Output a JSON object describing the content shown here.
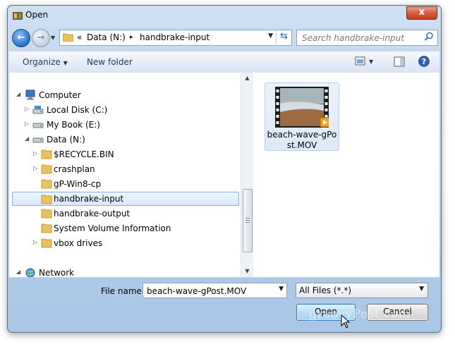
{
  "window": {
    "title": "Open",
    "close_glyph": "x"
  },
  "nav": {
    "back_icon": "back-arrow-icon",
    "forward_icon": "forward-arrow-icon"
  },
  "address": {
    "overflow": "«",
    "segments": [
      "Data (N:)",
      "handbrake-input"
    ],
    "separator": "▸"
  },
  "search": {
    "placeholder": "Search handbrake-input"
  },
  "toolbar": {
    "organize": "Organize",
    "new_folder": "New folder"
  },
  "tree": {
    "items": [
      {
        "label": "Computer",
        "icon": "computer-icon",
        "expander": "◢",
        "selected": false
      },
      {
        "label": "Local Disk (C:)",
        "icon": "drive-icon",
        "expander": "▷",
        "selected": false
      },
      {
        "label": "My Book (E:)",
        "icon": "drive-icon",
        "expander": "▷",
        "selected": false
      },
      {
        "label": "Data (N:)",
        "icon": "drive-icon",
        "expander": "◢",
        "selected": false
      },
      {
        "label": "$RECYCLE.BIN",
        "icon": "folder-icon",
        "expander": "▷",
        "selected": false
      },
      {
        "label": "crashplan",
        "icon": "folder-icon",
        "expander": "▷",
        "selected": false
      },
      {
        "label": "gP-Win8-cp",
        "icon": "folder-icon",
        "expander": "",
        "selected": false
      },
      {
        "label": "handbrake-input",
        "icon": "folder-icon",
        "expander": "",
        "selected": true
      },
      {
        "label": "handbrake-output",
        "icon": "folder-icon",
        "expander": "",
        "selected": false
      },
      {
        "label": "System Volume Information",
        "icon": "folder-icon",
        "expander": "",
        "selected": false
      },
      {
        "label": "vbox drives",
        "icon": "folder-icon",
        "expander": "▷",
        "selected": false
      },
      {
        "label": "Network",
        "icon": "network-icon",
        "expander": "◢",
        "selected": false
      }
    ]
  },
  "files": [
    {
      "name_line1": "beach-wave-gPo",
      "name_line2": "st.MOV",
      "icon": "video-thumbnail-icon"
    }
  ],
  "footer": {
    "filename_label": "File name:",
    "filename_value": "beach-wave-gPost.MOV",
    "filetype_value": "All Files (*.*)",
    "open_label": "Open",
    "cancel_label": "Cancel"
  },
  "watermark": "groovyPost.com",
  "colors": {
    "accent": "#2a6fc7",
    "selection_border": "#84acdd",
    "close_red": "#c33d1d"
  }
}
